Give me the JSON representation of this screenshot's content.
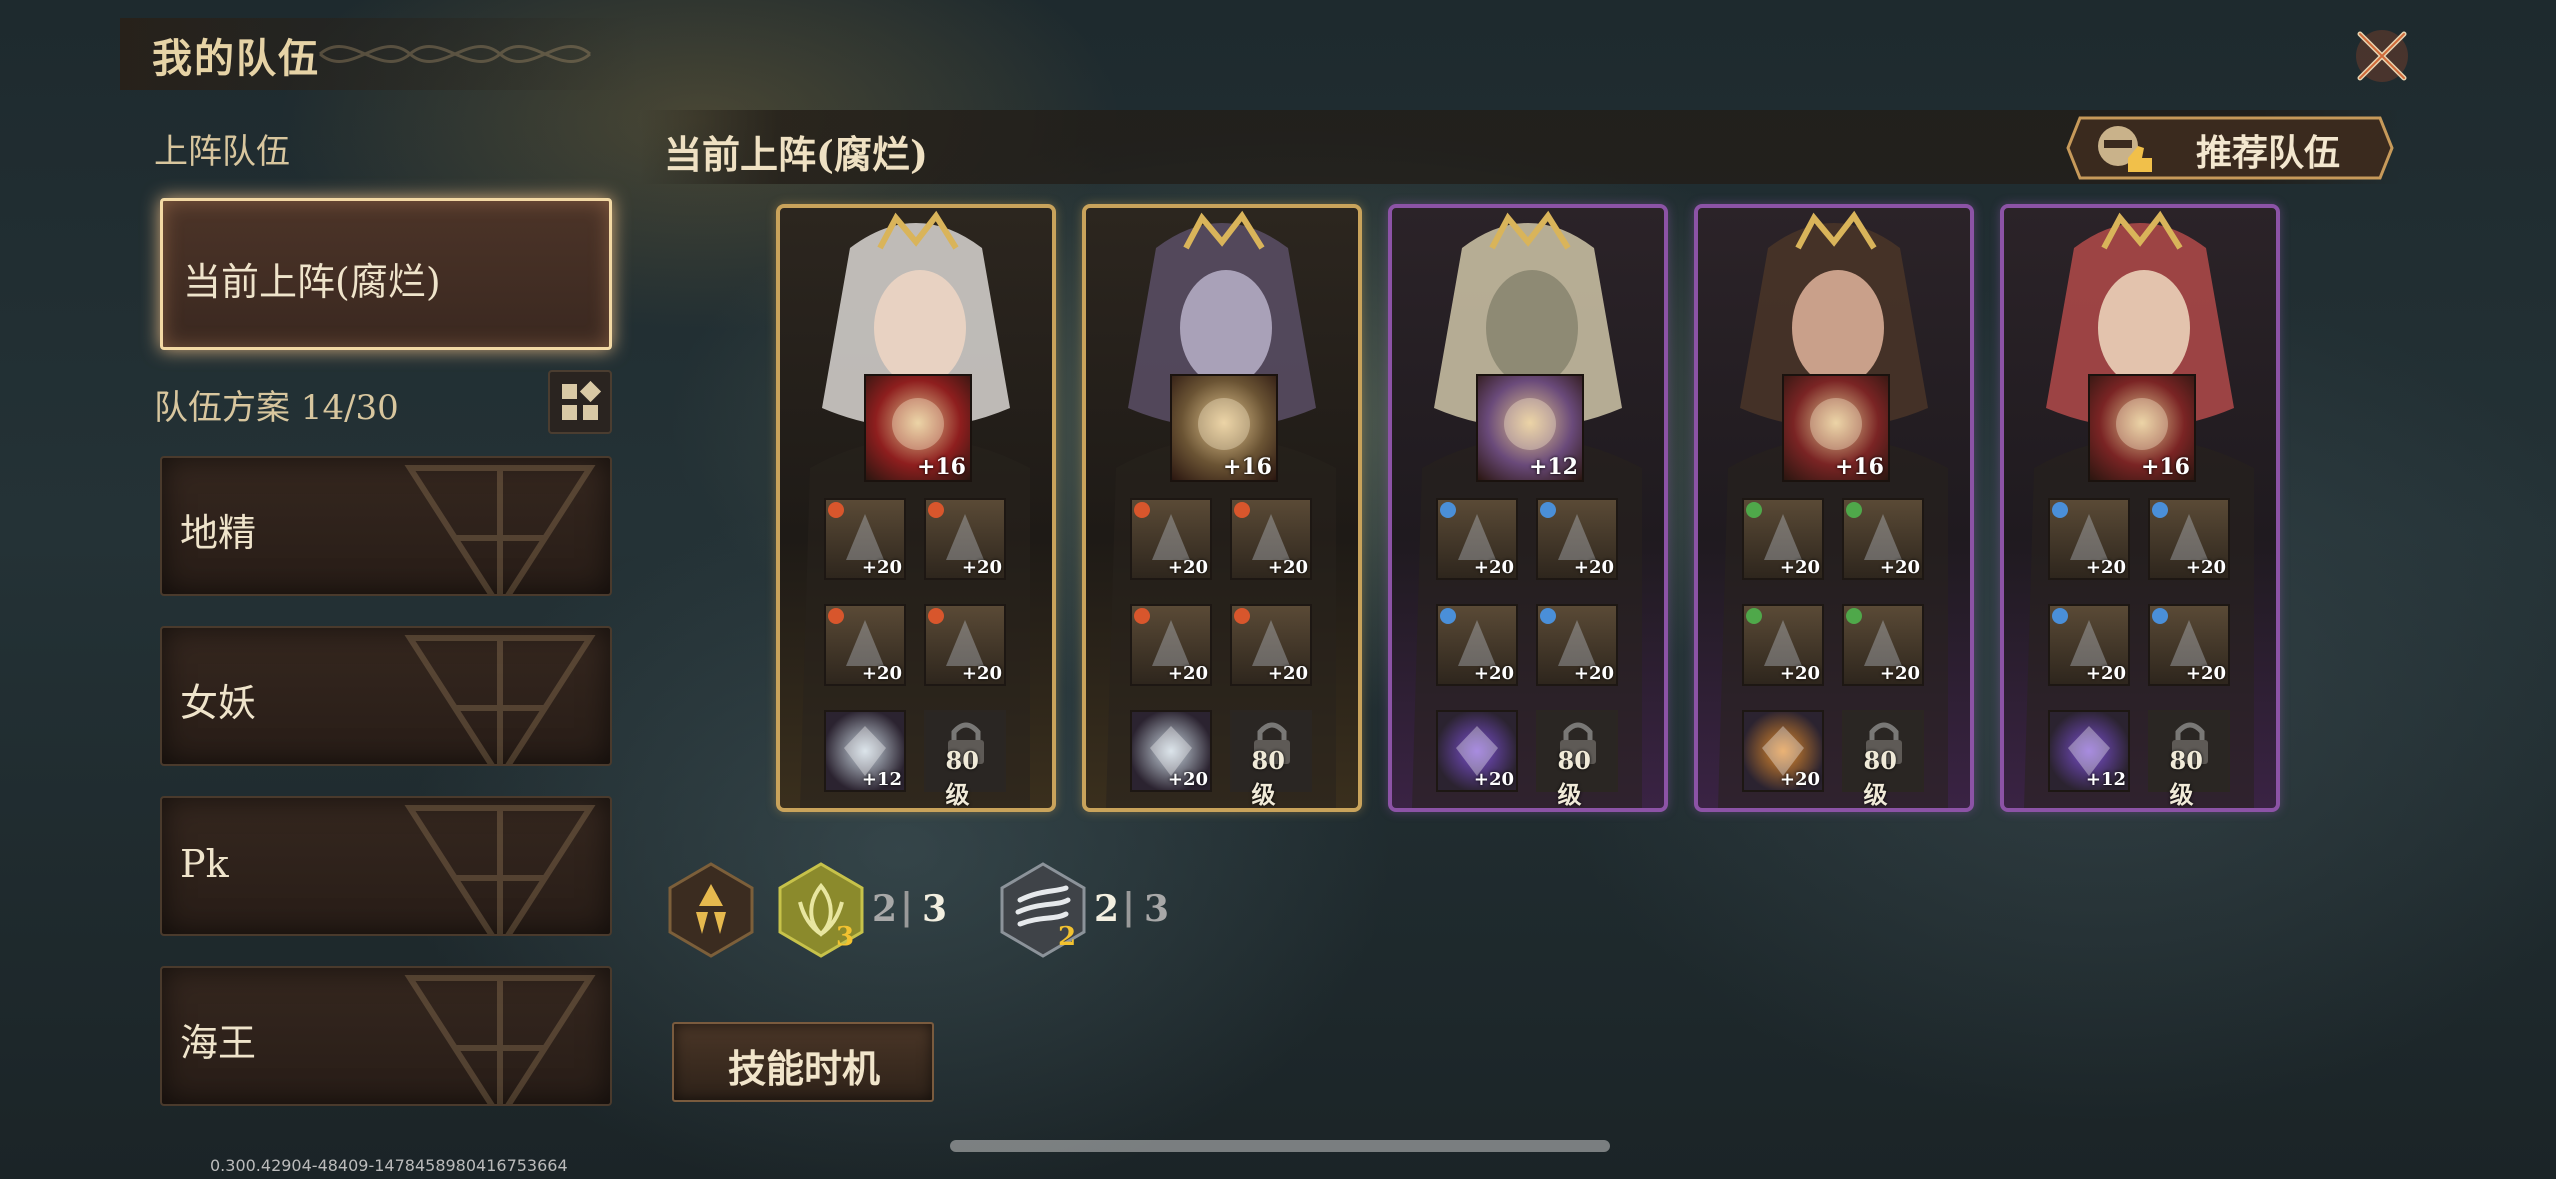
{
  "header": {
    "title": "我的队伍"
  },
  "left_panel": {
    "deployed_label": "上阵队伍",
    "current_team": "当前上阵(腐烂)",
    "plan_label": "队伍方案 14/30",
    "teams": [
      "地精",
      "女妖",
      "Pk",
      "海王"
    ]
  },
  "main": {
    "title": "当前上阵(腐烂)",
    "recommend_label": "推荐队伍"
  },
  "heroes": [
    {
      "rarity": "gold",
      "main_level": "+16",
      "slots": [
        "+20",
        "+20",
        "+20",
        "+20"
      ],
      "rune_level": "+12",
      "lock_label": "80级"
    },
    {
      "rarity": "gold",
      "main_level": "+16",
      "slots": [
        "+20",
        "+20",
        "+20",
        "+20"
      ],
      "rune_level": "+20",
      "lock_label": "80级"
    },
    {
      "rarity": "purple",
      "main_level": "+12",
      "slots": [
        "+20",
        "+20",
        "+20",
        "+20"
      ],
      "rune_level": "+20",
      "lock_label": "80级"
    },
    {
      "rarity": "purple",
      "main_level": "+16",
      "slots": [
        "+20",
        "+20",
        "+20",
        "+20"
      ],
      "rune_level": "+20",
      "lock_label": "80级"
    },
    {
      "rarity": "purple",
      "main_level": "+16",
      "slots": [
        "+20",
        "+20",
        "+20",
        "+20"
      ],
      "rune_level": "+12",
      "lock_label": "80级"
    }
  ],
  "synergy": {
    "s1": {
      "count": "3",
      "current": "2",
      "sep": "|",
      "max": "3"
    },
    "s2": {
      "count": "2",
      "current": "2",
      "sep": "|",
      "max": "3"
    }
  },
  "skill_timing_label": "技能时机",
  "version": "0.300.42904-48409-14784589804167536​64"
}
